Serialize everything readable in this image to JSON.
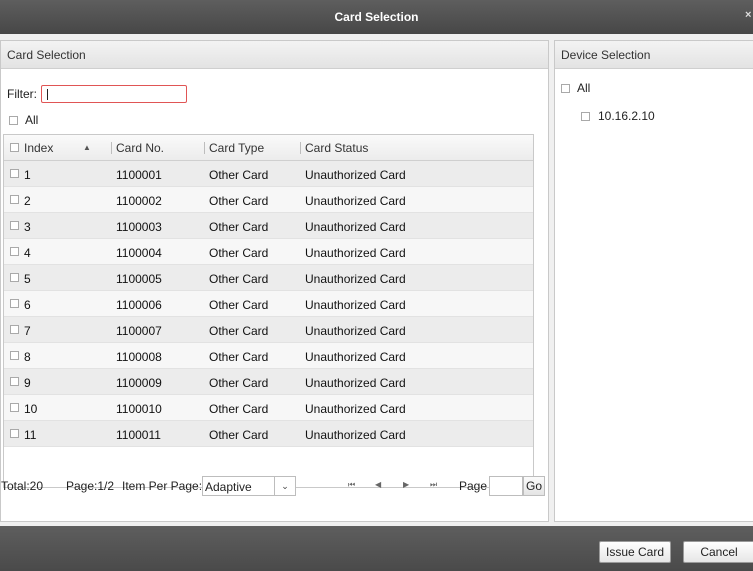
{
  "window": {
    "title": "Card Selection",
    "close_glyph": "×"
  },
  "card_panel": {
    "title": "Card Selection",
    "filter_label": "Filter:",
    "filter_value": "",
    "all_label": "All"
  },
  "table": {
    "columns": {
      "index": "Index",
      "card_no": "Card No.",
      "card_type": "Card Type",
      "card_status": "Card Status"
    },
    "sort_glyph": "▲",
    "rows": [
      {
        "index": "1",
        "card_no": "1100001",
        "card_type": "Other Card",
        "card_status": "Unauthorized Card"
      },
      {
        "index": "2",
        "card_no": "1100002",
        "card_type": "Other Card",
        "card_status": "Unauthorized Card"
      },
      {
        "index": "3",
        "card_no": "1100003",
        "card_type": "Other Card",
        "card_status": "Unauthorized Card"
      },
      {
        "index": "4",
        "card_no": "1100004",
        "card_type": "Other Card",
        "card_status": "Unauthorized Card"
      },
      {
        "index": "5",
        "card_no": "1100005",
        "card_type": "Other Card",
        "card_status": "Unauthorized Card"
      },
      {
        "index": "6",
        "card_no": "1100006",
        "card_type": "Other Card",
        "card_status": "Unauthorized Card"
      },
      {
        "index": "7",
        "card_no": "1100007",
        "card_type": "Other Card",
        "card_status": "Unauthorized Card"
      },
      {
        "index": "8",
        "card_no": "1100008",
        "card_type": "Other Card",
        "card_status": "Unauthorized Card"
      },
      {
        "index": "9",
        "card_no": "1100009",
        "card_type": "Other Card",
        "card_status": "Unauthorized Card"
      },
      {
        "index": "10",
        "card_no": "1100010",
        "card_type": "Other Card",
        "card_status": "Unauthorized Card"
      },
      {
        "index": "11",
        "card_no": "1100011",
        "card_type": "Other Card",
        "card_status": "Unauthorized Card"
      }
    ]
  },
  "pagination": {
    "total_text": "Total:20",
    "page_text": "Page:1/2",
    "per_page_label": "Item Per Page:",
    "per_page_value": "Adaptive",
    "page_label": "Page",
    "page_input_value": "",
    "go_label": "Go",
    "icons": {
      "first": "⏮",
      "prev": "◀",
      "next": "▶",
      "last": "⏭"
    }
  },
  "device_panel": {
    "title": "Device Selection",
    "all_label": "All",
    "devices": [
      "10.16.2.10"
    ]
  },
  "actions": {
    "issue_card": "Issue Card",
    "cancel": "Cancel"
  }
}
